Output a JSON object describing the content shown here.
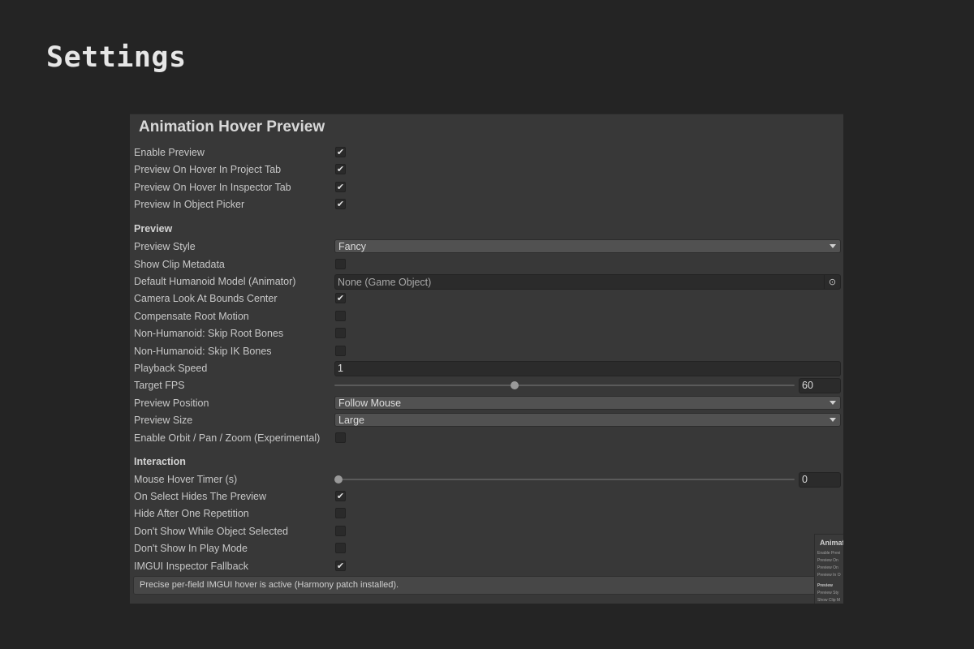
{
  "page": {
    "title": "Settings"
  },
  "panel": {
    "header": "Animation Hover Preview",
    "general": [
      {
        "label": "Enable Preview",
        "checked": true
      },
      {
        "label": "Preview On Hover In Project Tab",
        "checked": true
      },
      {
        "label": "Preview On Hover In Inspector Tab",
        "checked": true
      },
      {
        "label": "Preview In Object Picker",
        "checked": true
      }
    ],
    "preview_section": {
      "title": "Preview",
      "preview_style": {
        "label": "Preview Style",
        "value": "Fancy"
      },
      "show_clip_metadata": {
        "label": "Show Clip Metadata",
        "checked": false
      },
      "default_model": {
        "label": "Default Humanoid Model (Animator)",
        "value": "None (Game Object)"
      },
      "camera_look": {
        "label": "Camera Look At Bounds Center",
        "checked": true
      },
      "compensate_root": {
        "label": "Compensate Root Motion",
        "checked": false
      },
      "skip_root_bones": {
        "label": "Non-Humanoid: Skip Root Bones",
        "checked": false
      },
      "skip_ik_bones": {
        "label": "Non-Humanoid: Skip IK Bones",
        "checked": false
      },
      "playback_speed": {
        "label": "Playback Speed",
        "value": "1"
      },
      "target_fps": {
        "label": "Target FPS",
        "value": "60",
        "fraction": 0.39
      },
      "preview_position": {
        "label": "Preview Position",
        "value": "Follow Mouse"
      },
      "preview_size": {
        "label": "Preview Size",
        "value": "Large"
      },
      "enable_orbit": {
        "label": "Enable Orbit / Pan / Zoom (Experimental)",
        "checked": false
      }
    },
    "interaction_section": {
      "title": "Interaction",
      "hover_timer": {
        "label": "Mouse Hover Timer (s)",
        "value": "0",
        "fraction": 0.0
      },
      "on_select_hides": {
        "label": "On Select Hides The Preview",
        "checked": true
      },
      "hide_after_one": {
        "label": "Hide After One Repetition",
        "checked": false
      },
      "dont_show_selected": {
        "label": "Don't Show While Object Selected",
        "checked": false
      },
      "dont_show_play": {
        "label": "Don't Show In Play Mode",
        "checked": false
      },
      "imgui_fallback": {
        "label": "IMGUI Inspector Fallback",
        "checked": true
      }
    },
    "helpbox": "Precise per-field IMGUI hover is active (Harmony patch installed).",
    "mini_preview": {
      "title": "Animati",
      "lines": [
        "Enable Previ",
        "Preview On",
        "Preview On",
        "Preview In O"
      ],
      "section": "Preview",
      "lines2": [
        "Preview Sty",
        "Show Clip M"
      ]
    }
  },
  "icons": {
    "check": "✔",
    "picker": "⊙"
  },
  "colors": {
    "background": "#242424",
    "panel": "#383838",
    "field": "#2b2b2b",
    "dropdown": "#515151"
  }
}
